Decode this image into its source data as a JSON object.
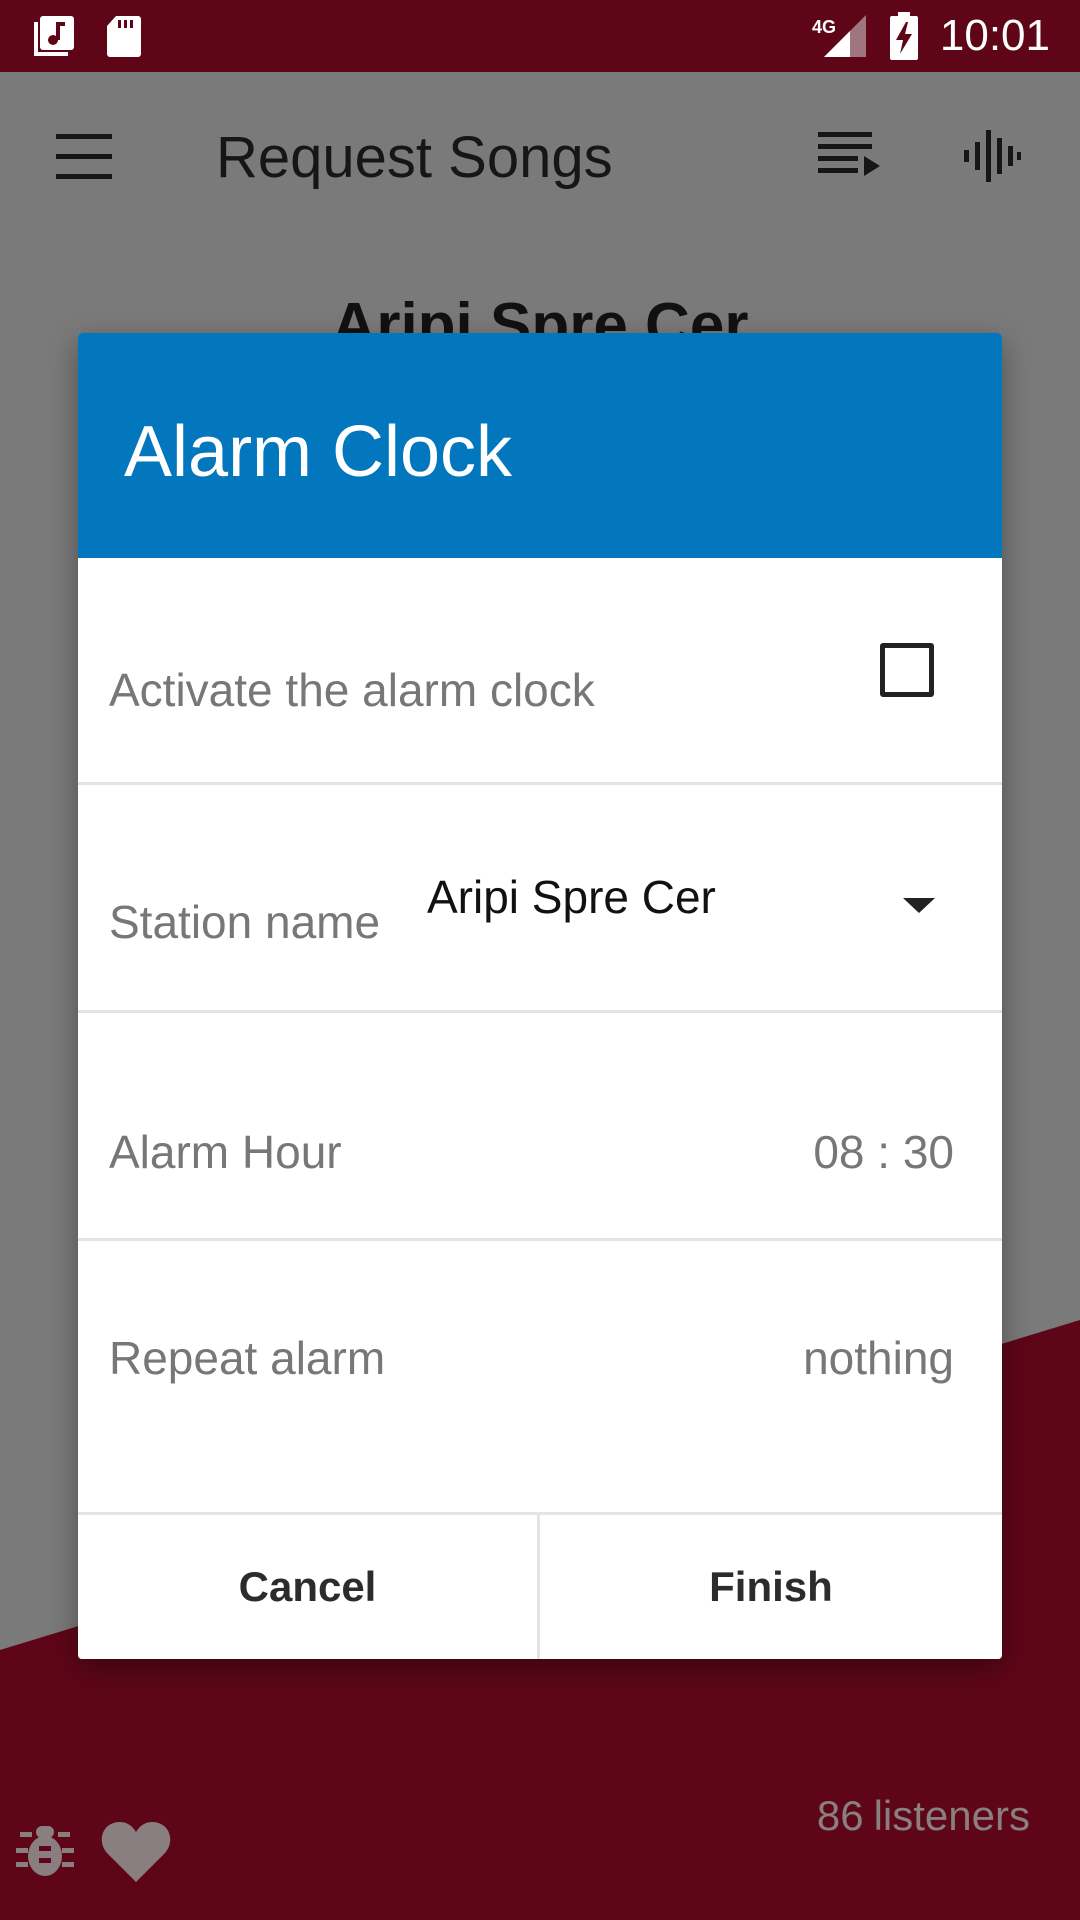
{
  "status_bar": {
    "time": "10:01",
    "network": "4G",
    "icons": [
      "music-note-icon",
      "sd-card-icon",
      "signal-icon",
      "battery-charging-icon"
    ]
  },
  "app_bar": {
    "title": "Request Songs",
    "icons": [
      "menu-icon",
      "queue-music-icon",
      "audio-waveform-icon"
    ]
  },
  "background": {
    "station_heading": "Aripi Spre Cer",
    "listeners_count": "86",
    "listeners_label": "listeners",
    "bottom_icons": [
      "bug-icon",
      "heart-icon"
    ]
  },
  "dialog": {
    "title": "Alarm Clock",
    "activate_label": "Activate the alarm clock",
    "activate_checked": false,
    "station_label": "Station name",
    "station_value": "Aripi Spre Cer",
    "hour_label": "Alarm Hour",
    "hour_value": "08 : 30",
    "repeat_label": "Repeat alarm",
    "repeat_value": "nothing",
    "cancel_label": "Cancel",
    "finish_label": "Finish"
  },
  "colors": {
    "status_bar": "#5e0618",
    "dialog_header": "#0277bd",
    "scrim_gray": "#7a7a7a",
    "maroon_accent": "#5e0618"
  }
}
